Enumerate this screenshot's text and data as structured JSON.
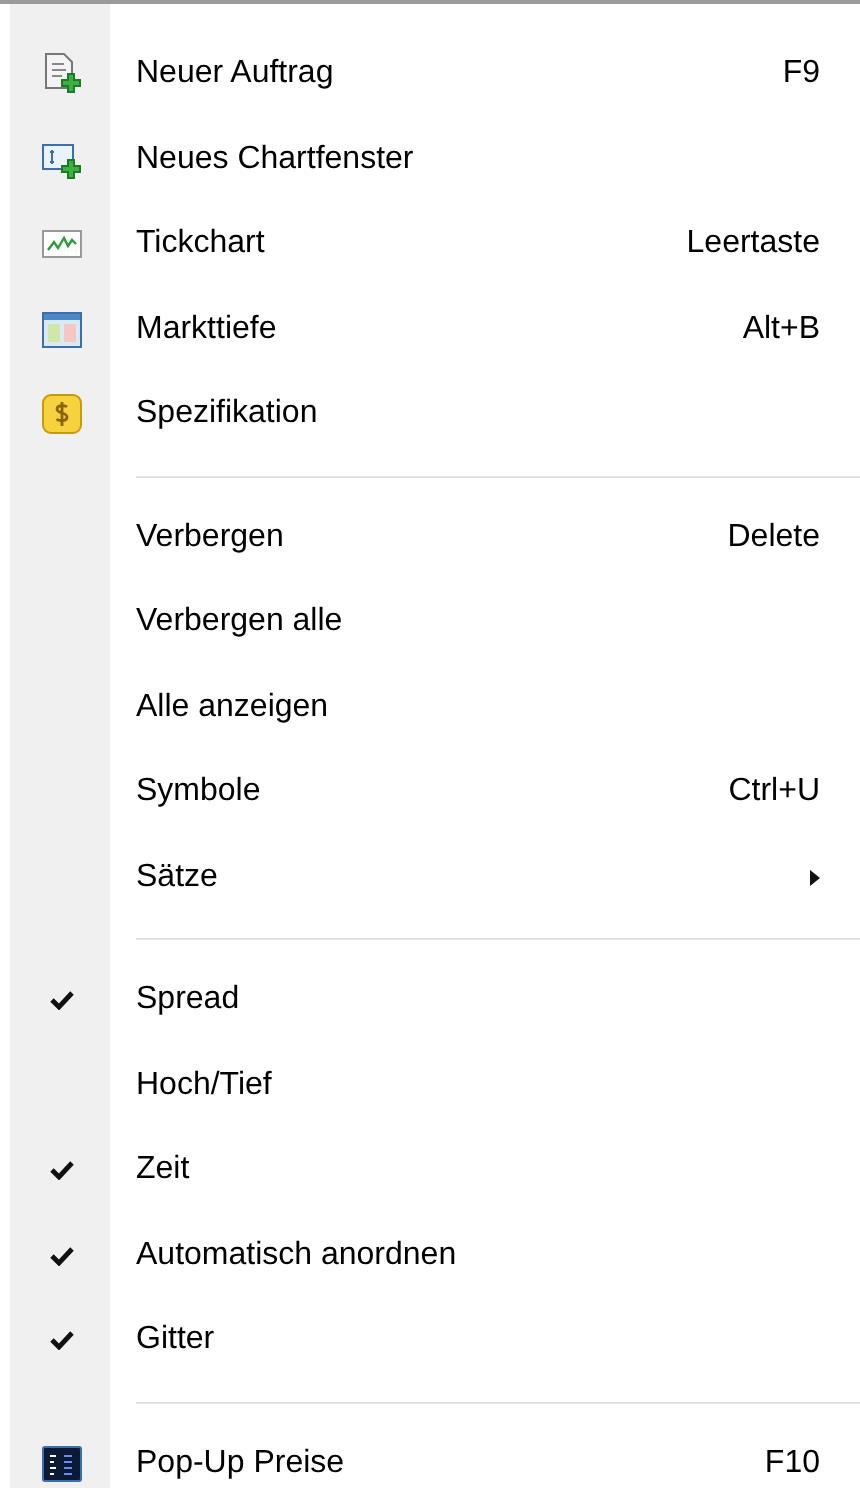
{
  "menu": {
    "groups": [
      {
        "items": [
          {
            "label": "Neuer Auftrag",
            "shortcut": "F9",
            "kind": "icon"
          },
          {
            "label": "Neues Chartfenster",
            "kind": "icon"
          },
          {
            "label": "Tickchart",
            "shortcut": "Leertaste",
            "kind": "icon"
          },
          {
            "label": "Markttiefe",
            "shortcut": "Alt+B",
            "kind": "icon"
          },
          {
            "label": "Spezifikation",
            "kind": "icon"
          }
        ]
      },
      {
        "items": [
          {
            "label": "Verbergen",
            "shortcut": "Delete",
            "kind": "plain"
          },
          {
            "label": "Verbergen alle",
            "kind": "plain"
          },
          {
            "label": "Alle anzeigen",
            "kind": "plain"
          },
          {
            "label": "Symbole",
            "shortcut": "Ctrl+U",
            "kind": "plain"
          },
          {
            "label": "Sätze",
            "kind": "submenu"
          }
        ]
      },
      {
        "items": [
          {
            "label": "Spread",
            "kind": "check",
            "checked": true
          },
          {
            "label": "Hoch/Tief",
            "kind": "check",
            "checked": false
          },
          {
            "label": "Zeit",
            "kind": "check",
            "checked": true
          },
          {
            "label": "Automatisch anordnen",
            "kind": "check",
            "checked": true
          },
          {
            "label": "Gitter",
            "kind": "check",
            "checked": true
          }
        ]
      },
      {
        "items": [
          {
            "label": "Pop-Up Preise",
            "shortcut": "F10",
            "kind": "icon"
          }
        ]
      }
    ]
  }
}
